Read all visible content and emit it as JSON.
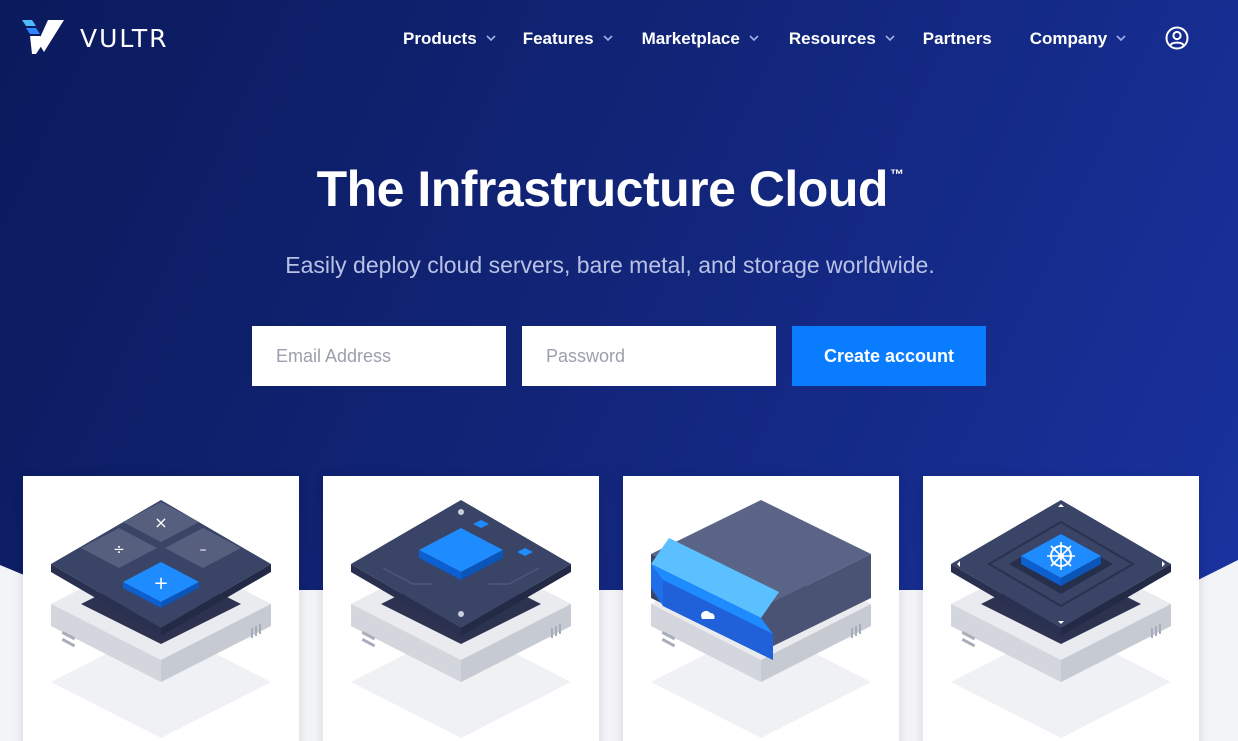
{
  "brand": {
    "name": "VULTR",
    "logo_icon": "vultr-v-logo"
  },
  "nav": {
    "items": [
      {
        "label": "Products",
        "has_dropdown": true
      },
      {
        "label": "Features",
        "has_dropdown": true
      },
      {
        "label": "Marketplace",
        "has_dropdown": true
      },
      {
        "label": "Resources",
        "has_dropdown": true
      },
      {
        "label": "Partners",
        "has_dropdown": false
      },
      {
        "label": "Company",
        "has_dropdown": true
      }
    ],
    "account_icon": "user-circle-icon"
  },
  "hero": {
    "title": "The Infrastructure Cloud",
    "title_mark": "™",
    "subtitle": "Easily deploy cloud servers, bare metal, and storage worldwide."
  },
  "signup": {
    "email_placeholder": "Email Address",
    "password_placeholder": "Password",
    "submit_label": "Create account"
  },
  "cards": [
    {
      "icon": "calculator-server-icon"
    },
    {
      "icon": "chip-server-icon"
    },
    {
      "icon": "storage-drive-server-icon"
    },
    {
      "icon": "kubernetes-server-icon"
    }
  ],
  "colors": {
    "accent": "#0a7cff",
    "hero_dark": "#0b1a5c",
    "hero_light": "#1a34a2",
    "subtitle": "#b9c2e6"
  }
}
